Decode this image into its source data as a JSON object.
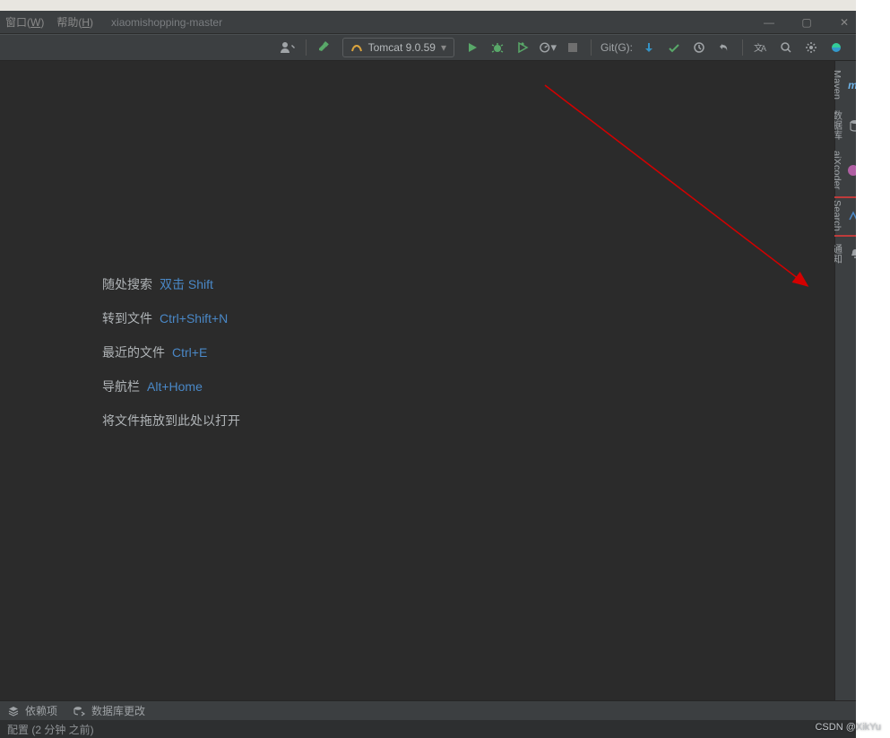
{
  "menu": {
    "window": "窗口",
    "window_hot": "W",
    "help": "帮助",
    "help_hot": "H"
  },
  "project_title": "xiaomishopping-master",
  "run_config": {
    "label": "Tomcat 9.0.59"
  },
  "vcs_label": "Git(G):",
  "hints": {
    "search_label": "随处搜索",
    "search_key": "双击 Shift",
    "gotofile_label": "转到文件",
    "gotofile_key": "Ctrl+Shift+N",
    "recent_label": "最近的文件",
    "recent_key": "Ctrl+E",
    "navbar_label": "导航栏",
    "navbar_key": "Alt+Home",
    "drop_label": "将文件拖放到此处以打开"
  },
  "right_tools": {
    "maven": "Maven",
    "database": "数据库",
    "aixcoder": "aiXcoder",
    "search": "Search",
    "notify": "通知"
  },
  "status": {
    "dependencies": "依赖项",
    "db_update": "数据库更改"
  },
  "status2": "配置 (2 分钟 之前)",
  "watermark": "CSDN @XikYu"
}
